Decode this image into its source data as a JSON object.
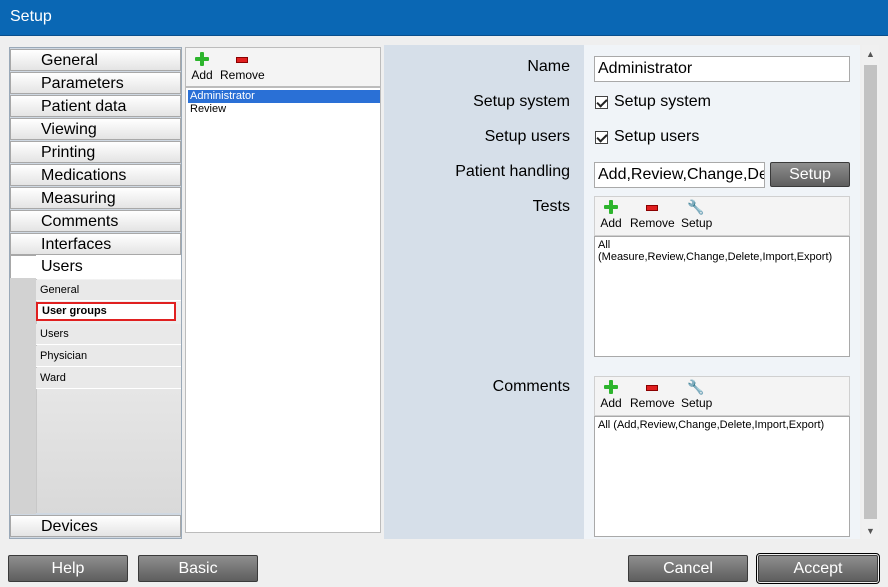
{
  "window": {
    "title": "Setup"
  },
  "nav": {
    "items": [
      "General",
      "Parameters",
      "Patient data",
      "Viewing",
      "Printing",
      "Medications",
      "Measuring",
      "Comments",
      "Interfaces"
    ],
    "users_header": "Users",
    "sub_items": [
      "General",
      "User groups",
      "Users",
      "Physician",
      "Ward"
    ],
    "selected_sub": "User groups",
    "bottom_item": "Devices"
  },
  "group_list": {
    "add_label": "Add",
    "remove_label": "Remove",
    "items": [
      "Administrator",
      "Review"
    ],
    "selected": "Administrator"
  },
  "form": {
    "name_label": "Name",
    "name_value": "Administrator",
    "setup_system_label": "Setup system",
    "setup_system_check": "Setup system",
    "setup_users_label": "Setup users",
    "setup_users_check": "Setup users",
    "patient_handling_label": "Patient handling",
    "patient_handling_value": "Add,Review,Change,De",
    "patient_handling_button": "Setup",
    "tests_label": "Tests",
    "tests_add": "Add",
    "tests_remove": "Remove",
    "tests_setup": "Setup",
    "tests_value": "All (Measure,Review,Change,Delete,Import,Export)",
    "comments_label": "Comments",
    "comments_add": "Add",
    "comments_remove": "Remove",
    "comments_setup": "Setup",
    "comments_value": "All (Add,Review,Change,Delete,Import,Export)"
  },
  "footer": {
    "help": "Help",
    "basic": "Basic",
    "cancel": "Cancel",
    "accept": "Accept"
  },
  "icons": {
    "add": "plus-icon",
    "remove": "minus-icon",
    "setup": "wrench-icon"
  },
  "colors": {
    "titlebar": "#0a67b4",
    "selection": "#2a70d6",
    "highlight_border": "#e02020"
  }
}
